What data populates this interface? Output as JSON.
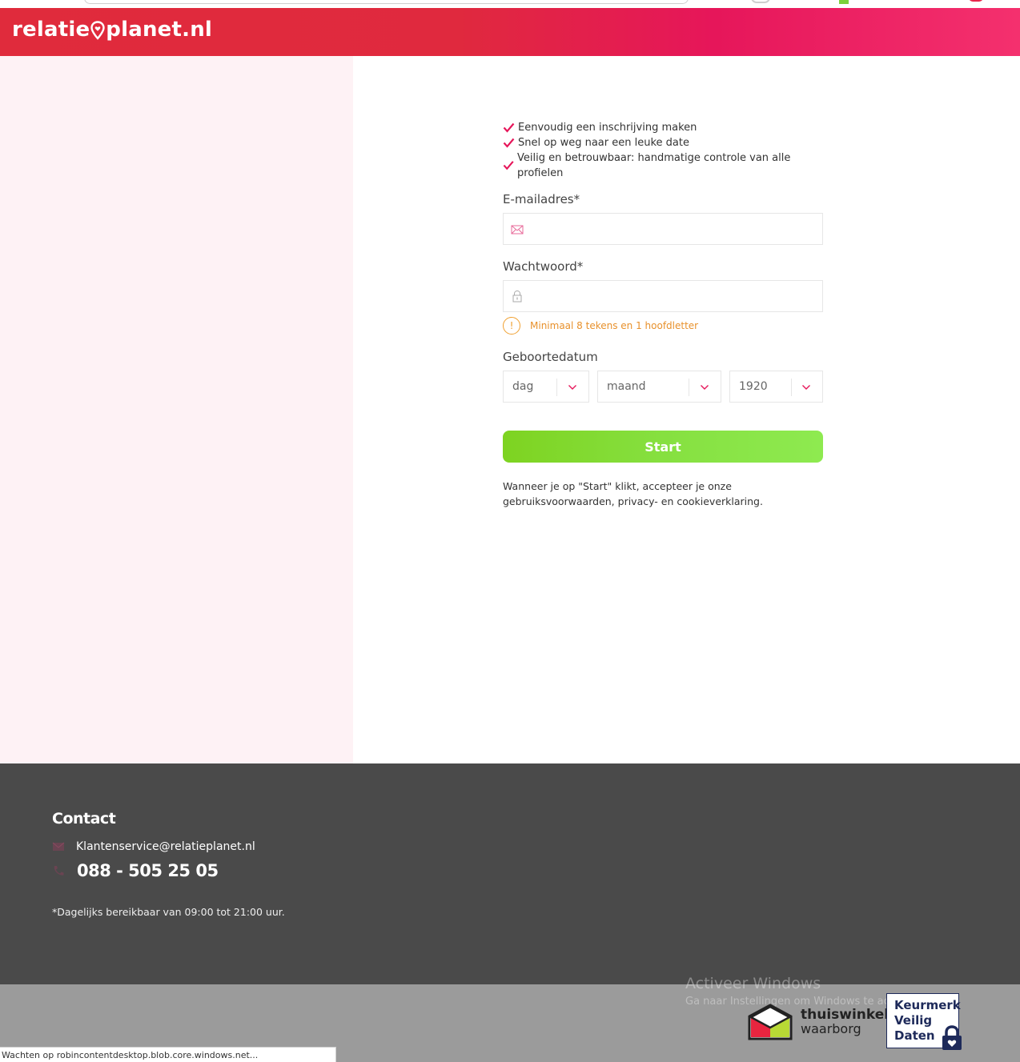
{
  "brand": {
    "name_part1": "relatie",
    "name_part2": "planet.nl"
  },
  "usps": [
    "Eenvoudig een inschrijving maken",
    "Snel op weg naar een leuke date",
    "Veilig en betrouwbaar: handmatige controle van alle profielen"
  ],
  "form": {
    "email_label": "E-mailadres*",
    "email_value": "",
    "password_label": "Wachtwoord*",
    "password_value": "",
    "password_hint": "Minimaal 8 tekens en 1 hoofdletter",
    "birthdate_label": "Geboortedatum",
    "day_value": "dag",
    "month_value": "maand",
    "year_value": "1920",
    "start_label": "Start",
    "terms_text": "Wanneer je op \"Start\" klikt, accepteer je onze gebruiksvoorwaarden, privacy- en cookieverklaring."
  },
  "footer": {
    "contact_title": "Contact",
    "email": "Klantenservice@relatieplanet.nl",
    "phone": "088 - 505 25 05",
    "hours": "*Dagelijks bereikbaar van 09:00 tot 21:00 uur."
  },
  "badges": {
    "thuiswinkel_line1": "thuiswinkel",
    "thuiswinkel_line2": "waarborg",
    "keurmerk_line1": "Keurmerk",
    "keurmerk_line2": "Veilig",
    "keurmerk_line3": "Daten"
  },
  "windows_watermark": {
    "line1": "Activeer Windows",
    "line2": "Ga naar Instellingen om Windows te activeren."
  },
  "status_text": "Wachten op robincontentdesktop.blob.core.windows.net...",
  "colors": {
    "brand_red": "#e02b3c",
    "brand_pink": "#f4306e",
    "accent_green": "#7ed321",
    "hint_orange": "#e8912c",
    "footer_bg": "#4a4a4a"
  }
}
